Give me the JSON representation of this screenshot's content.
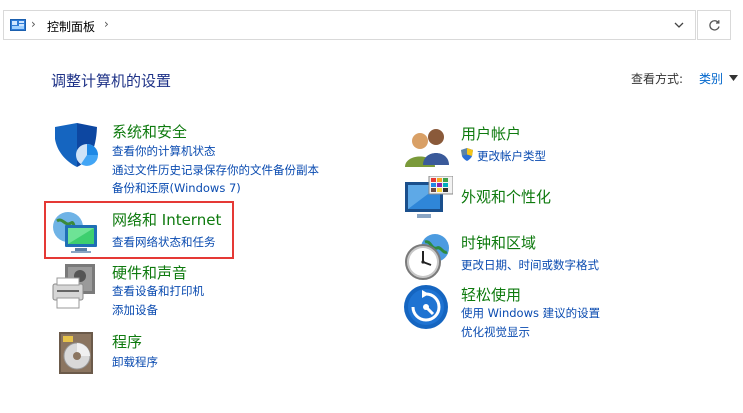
{
  "address_bar": {
    "breadcrumb": "控制面板"
  },
  "page_title": "调整计算机的设置",
  "view_by": {
    "label": "查看方式:",
    "value": "类别"
  },
  "categories": [
    {
      "title": "系统和安全",
      "links": [
        "查看你的计算机状态",
        "通过文件历史记录保存你的文件备份副本",
        "备份和还原(Windows 7)"
      ],
      "icon": "shield-icon"
    },
    {
      "title": "网络和 Internet",
      "links": [
        "查看网络状态和任务"
      ],
      "icon": "network-globe-icon"
    },
    {
      "title": "硬件和声音",
      "links": [
        "查看设备和打印机",
        "添加设备"
      ],
      "icon": "printer-speaker-icon"
    },
    {
      "title": "程序",
      "links": [
        "卸载程序"
      ],
      "icon": "programs-disk-icon"
    },
    {
      "title": "用户帐户",
      "links": [
        "更改帐户类型"
      ],
      "icon": "users-icon"
    },
    {
      "title": "外观和个性化",
      "links": [],
      "icon": "monitor-palette-icon"
    },
    {
      "title": "时钟和区域",
      "links": [
        "更改日期、时间或数字格式"
      ],
      "icon": "clock-globe-icon"
    },
    {
      "title": "轻松使用",
      "links": [
        "使用 Windows 建议的设置",
        "优化视觉显示"
      ],
      "icon": "ease-of-access-icon"
    }
  ],
  "colors": {
    "title_green": "#0e7a0e",
    "link_blue": "#0a4bb0",
    "heading_blue": "#1e3287",
    "highlight_red": "#e53935"
  }
}
